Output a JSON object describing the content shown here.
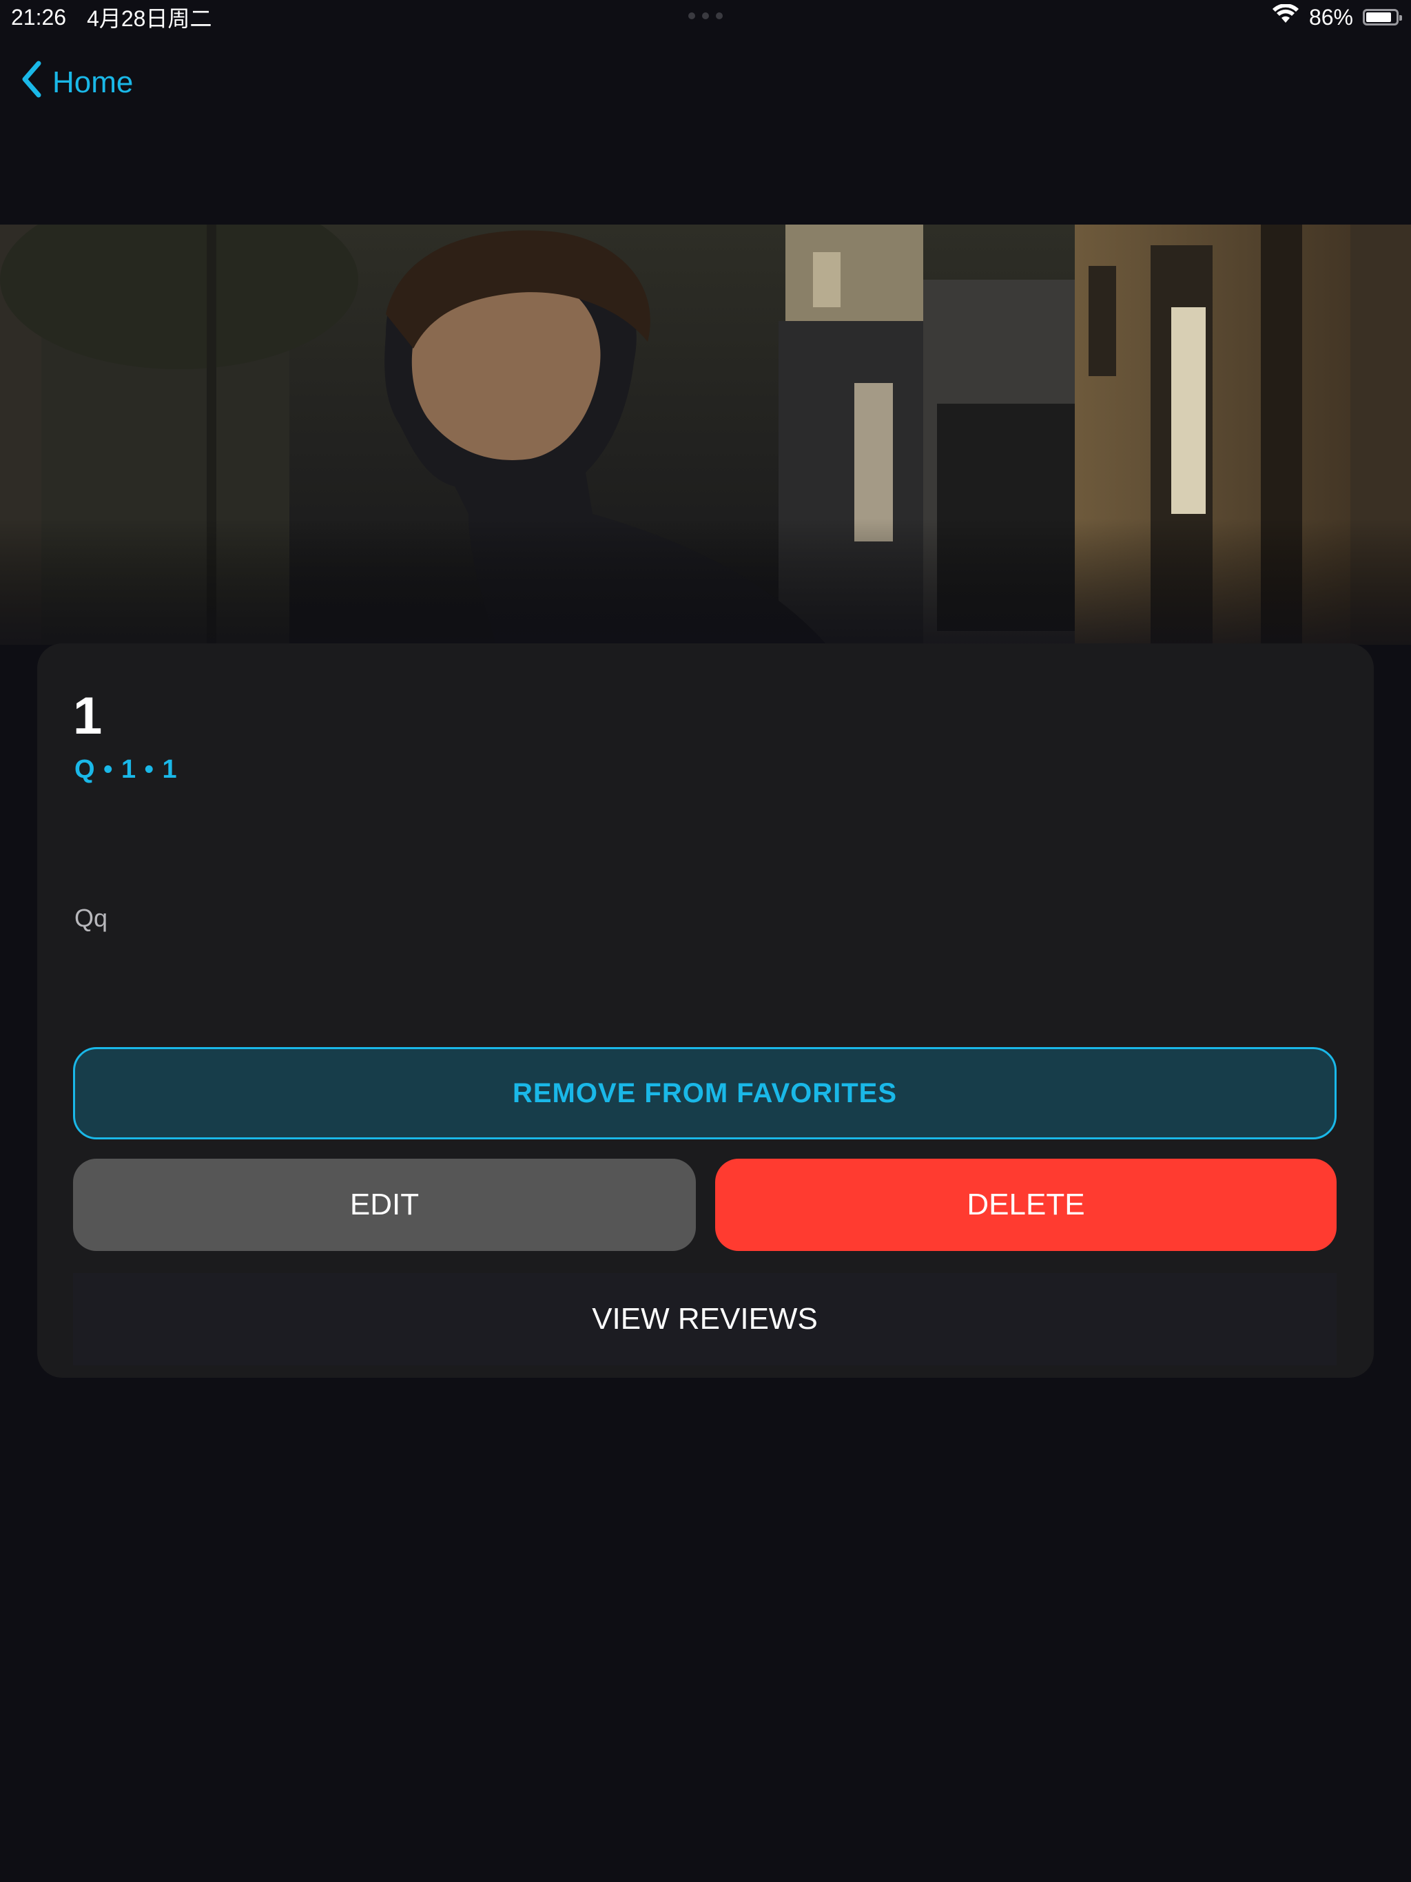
{
  "status_bar": {
    "time": "21:26",
    "date": "4月28日周二",
    "battery": "86%",
    "battery_level": 0.86
  },
  "nav": {
    "back_label": "Home"
  },
  "item": {
    "title": "1",
    "meta": "Q • 1 • 1",
    "description": "Qq"
  },
  "actions": {
    "favorite_label": "REMOVE FROM FAVORITES",
    "edit_label": "EDIT",
    "delete_label": "DELETE",
    "reviews_label": "VIEW REVIEWS"
  },
  "colors": {
    "accent": "#1ab8e8",
    "background": "#0e0e14",
    "card": "#1b1b1d",
    "favorite_bg": "#173d4a",
    "edit_bg": "#565656",
    "delete_bg": "#ff3b30"
  },
  "icons": {
    "back": "chevron-left-icon",
    "wifi": "wifi-icon",
    "battery": "battery-icon"
  }
}
